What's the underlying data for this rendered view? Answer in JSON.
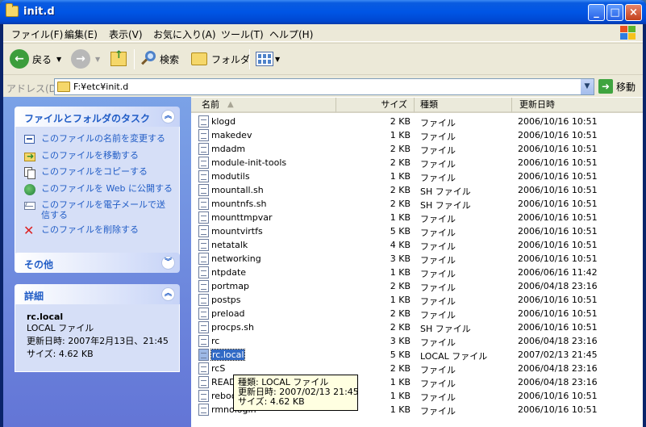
{
  "window": {
    "title": "init.d",
    "minimize": "_",
    "maximize": "□",
    "close": "×"
  },
  "menu": [
    "ファイル(F)",
    "編集(E)",
    "表示(V)",
    "お気に入り(A)",
    "ツール(T)",
    "ヘルプ(H)"
  ],
  "toolbar": {
    "back": "戻る",
    "search": "検索",
    "folders": "フォルダ"
  },
  "address": {
    "label": "アドレス(D)",
    "value": "F:¥etc¥init.d",
    "go": "移動"
  },
  "tasks_panel": {
    "title": "ファイルとフォルダのタスク",
    "items": [
      {
        "label": "このファイルの名前を変更する",
        "icon": "rename-icon"
      },
      {
        "label": "このファイルを移動する",
        "icon": "move-icon"
      },
      {
        "label": "このファイルをコピーする",
        "icon": "copy-icon"
      },
      {
        "label": "このファイルを Web に公開する",
        "icon": "web-publish-icon"
      },
      {
        "label": "このファイルを電子メールで送信する",
        "icon": "email-icon"
      },
      {
        "label": "このファイルを削除する",
        "icon": "delete-icon"
      }
    ]
  },
  "other_panel": {
    "title": "その他"
  },
  "details_panel": {
    "title": "詳細",
    "name": "rc.local",
    "type": "LOCAL ファイル",
    "modified": "更新日時: 2007年2月13日、21:45",
    "size": "サイズ: 4.62 KB"
  },
  "columns": {
    "name": "名前",
    "size": "サイズ",
    "type": "種類",
    "date": "更新日時"
  },
  "files": [
    {
      "name": "klogd",
      "size": "2 KB",
      "type": "ファイル",
      "date": "2006/10/16 10:51"
    },
    {
      "name": "makedev",
      "size": "1 KB",
      "type": "ファイル",
      "date": "2006/10/16 10:51"
    },
    {
      "name": "mdadm",
      "size": "2 KB",
      "type": "ファイル",
      "date": "2006/10/16 10:51"
    },
    {
      "name": "module-init-tools",
      "size": "2 KB",
      "type": "ファイル",
      "date": "2006/10/16 10:51"
    },
    {
      "name": "modutils",
      "size": "1 KB",
      "type": "ファイル",
      "date": "2006/10/16 10:51"
    },
    {
      "name": "mountall.sh",
      "size": "2 KB",
      "type": "SH ファイル",
      "date": "2006/10/16 10:51"
    },
    {
      "name": "mountnfs.sh",
      "size": "2 KB",
      "type": "SH ファイル",
      "date": "2006/10/16 10:51"
    },
    {
      "name": "mounttmpvar",
      "size": "1 KB",
      "type": "ファイル",
      "date": "2006/10/16 10:51"
    },
    {
      "name": "mountvirtfs",
      "size": "5 KB",
      "type": "ファイル",
      "date": "2006/10/16 10:51"
    },
    {
      "name": "netatalk",
      "size": "4 KB",
      "type": "ファイル",
      "date": "2006/10/16 10:51"
    },
    {
      "name": "networking",
      "size": "3 KB",
      "type": "ファイル",
      "date": "2006/10/16 10:51"
    },
    {
      "name": "ntpdate",
      "size": "1 KB",
      "type": "ファイル",
      "date": "2006/06/16 11:42"
    },
    {
      "name": "portmap",
      "size": "2 KB",
      "type": "ファイル",
      "date": "2006/04/18 23:16"
    },
    {
      "name": "postps",
      "size": "1 KB",
      "type": "ファイル",
      "date": "2006/10/16 10:51"
    },
    {
      "name": "preload",
      "size": "2 KB",
      "type": "ファイル",
      "date": "2006/10/16 10:51"
    },
    {
      "name": "procps.sh",
      "size": "2 KB",
      "type": "SH ファイル",
      "date": "2006/10/16 10:51"
    },
    {
      "name": "rc",
      "size": "3 KB",
      "type": "ファイル",
      "date": "2006/04/18 23:16"
    },
    {
      "name": "rc.local",
      "size": "5 KB",
      "type": "LOCAL ファイル",
      "date": "2007/02/13 21:45",
      "selected": true
    },
    {
      "name": "rcS",
      "size": "2 KB",
      "type": "ファイル",
      "date": "2006/04/18 23:16"
    },
    {
      "name": "README",
      "size": "1 KB",
      "type": "ファイル",
      "date": "2006/04/18 23:16"
    },
    {
      "name": "reboot",
      "size": "1 KB",
      "type": "ファイル",
      "date": "2006/10/16 10:51"
    },
    {
      "name": "rmnologin",
      "size": "1 KB",
      "type": "ファイル",
      "date": "2006/10/16 10:51"
    }
  ],
  "tooltip": {
    "type": "種類: LOCAL ファイル",
    "modified": "更新日時: 2007/02/13 21:45",
    "size": "サイズ: 4.62 KB"
  }
}
